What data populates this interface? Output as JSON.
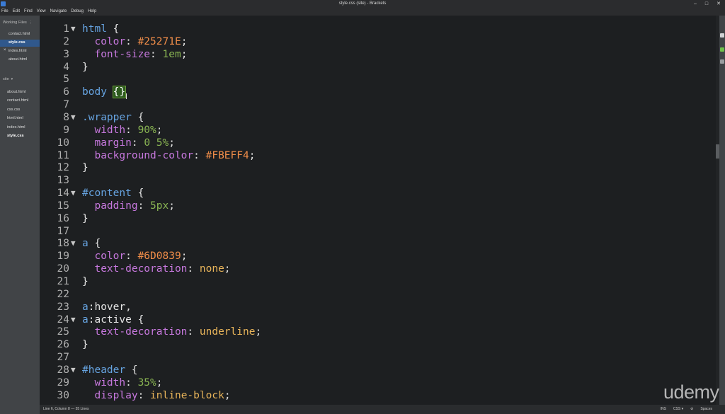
{
  "window": {
    "title": "style.css (site) - Brackets",
    "controls": [
      "–",
      "□",
      "✕"
    ]
  },
  "menu": [
    "File",
    "Edit",
    "Find",
    "View",
    "Navigate",
    "Debug",
    "Help"
  ],
  "sidebar": {
    "working_files_title": "Working Files",
    "working_files": [
      {
        "name": "contact.html",
        "selected": false,
        "dirty": false
      },
      {
        "name": "style.css",
        "selected": true,
        "dirty": false
      },
      {
        "name": "index.html",
        "selected": false,
        "dirty": true
      },
      {
        "name": "about.html",
        "selected": false,
        "dirty": false
      }
    ],
    "project_title": "site",
    "project_files": [
      "about.html",
      "contact.html",
      "css.css",
      "html.html",
      "index.html",
      "style.css"
    ]
  },
  "code_lines": [
    {
      "n": "1",
      "fold": true,
      "tokens": [
        {
          "t": "html",
          "c": "sel"
        },
        {
          "t": " {",
          "c": "punc"
        }
      ]
    },
    {
      "n": "2",
      "fold": false,
      "tokens": [
        {
          "t": "  color",
          "c": "prop"
        },
        {
          "t": ": ",
          "c": "punc"
        },
        {
          "t": "#25271E",
          "c": "hex"
        },
        {
          "t": ";",
          "c": "punc"
        }
      ]
    },
    {
      "n": "3",
      "fold": false,
      "tokens": [
        {
          "t": "  font-size",
          "c": "prop"
        },
        {
          "t": ": ",
          "c": "punc"
        },
        {
          "t": "1em",
          "c": "num"
        },
        {
          "t": ";",
          "c": "punc"
        }
      ]
    },
    {
      "n": "4",
      "fold": false,
      "tokens": [
        {
          "t": "}",
          "c": "punc"
        }
      ]
    },
    {
      "n": "5",
      "fold": false,
      "tokens": []
    },
    {
      "n": "6",
      "fold": false,
      "tokens": [
        {
          "t": "body",
          "c": "sel"
        },
        {
          "t": " ",
          "c": "punc"
        },
        {
          "t": "{}",
          "c": "match"
        }
      ]
    },
    {
      "n": "7",
      "fold": false,
      "tokens": []
    },
    {
      "n": "8",
      "fold": true,
      "tokens": [
        {
          "t": ".wrapper",
          "c": "sel"
        },
        {
          "t": " {",
          "c": "punc"
        }
      ]
    },
    {
      "n": "9",
      "fold": false,
      "tokens": [
        {
          "t": "  width",
          "c": "prop"
        },
        {
          "t": ": ",
          "c": "punc"
        },
        {
          "t": "90%",
          "c": "num"
        },
        {
          "t": ";",
          "c": "punc"
        }
      ]
    },
    {
      "n": "10",
      "fold": false,
      "tokens": [
        {
          "t": "  margin",
          "c": "prop"
        },
        {
          "t": ": ",
          "c": "punc"
        },
        {
          "t": "0 5%",
          "c": "num"
        },
        {
          "t": ";",
          "c": "punc"
        }
      ]
    },
    {
      "n": "11",
      "fold": false,
      "tokens": [
        {
          "t": "  background-color",
          "c": "prop"
        },
        {
          "t": ": ",
          "c": "punc"
        },
        {
          "t": "#FBEFF4",
          "c": "hex"
        },
        {
          "t": ";",
          "c": "punc"
        }
      ]
    },
    {
      "n": "12",
      "fold": false,
      "tokens": [
        {
          "t": "}",
          "c": "punc"
        }
      ]
    },
    {
      "n": "13",
      "fold": false,
      "tokens": []
    },
    {
      "n": "14",
      "fold": true,
      "tokens": [
        {
          "t": "#content",
          "c": "sel"
        },
        {
          "t": " {",
          "c": "punc"
        }
      ]
    },
    {
      "n": "15",
      "fold": false,
      "tokens": [
        {
          "t": "  padding",
          "c": "prop"
        },
        {
          "t": ": ",
          "c": "punc"
        },
        {
          "t": "5px",
          "c": "num"
        },
        {
          "t": ";",
          "c": "punc"
        }
      ]
    },
    {
      "n": "16",
      "fold": false,
      "tokens": [
        {
          "t": "}",
          "c": "punc"
        }
      ]
    },
    {
      "n": "17",
      "fold": false,
      "tokens": []
    },
    {
      "n": "18",
      "fold": true,
      "tokens": [
        {
          "t": "a",
          "c": "sel"
        },
        {
          "t": " {",
          "c": "punc"
        }
      ]
    },
    {
      "n": "19",
      "fold": false,
      "tokens": [
        {
          "t": "  color",
          "c": "prop"
        },
        {
          "t": ": ",
          "c": "punc"
        },
        {
          "t": "#6D0839",
          "c": "hex"
        },
        {
          "t": ";",
          "c": "punc"
        }
      ]
    },
    {
      "n": "20",
      "fold": false,
      "tokens": [
        {
          "t": "  text-decoration",
          "c": "prop"
        },
        {
          "t": ": ",
          "c": "punc"
        },
        {
          "t": "none",
          "c": "val"
        },
        {
          "t": ";",
          "c": "punc"
        }
      ]
    },
    {
      "n": "21",
      "fold": false,
      "tokens": [
        {
          "t": "}",
          "c": "punc"
        }
      ]
    },
    {
      "n": "22",
      "fold": false,
      "tokens": []
    },
    {
      "n": "23",
      "fold": false,
      "tokens": [
        {
          "t": "a",
          "c": "sel"
        },
        {
          "t": ":hover,",
          "c": "punc"
        }
      ]
    },
    {
      "n": "24",
      "fold": true,
      "tokens": [
        {
          "t": "a",
          "c": "sel"
        },
        {
          "t": ":active {",
          "c": "punc"
        }
      ]
    },
    {
      "n": "25",
      "fold": false,
      "tokens": [
        {
          "t": "  text-decoration",
          "c": "prop"
        },
        {
          "t": ": ",
          "c": "punc"
        },
        {
          "t": "underline",
          "c": "val"
        },
        {
          "t": ";",
          "c": "punc"
        }
      ]
    },
    {
      "n": "26",
      "fold": false,
      "tokens": [
        {
          "t": "}",
          "c": "punc"
        }
      ]
    },
    {
      "n": "27",
      "fold": false,
      "tokens": []
    },
    {
      "n": "28",
      "fold": true,
      "tokens": [
        {
          "t": "#header",
          "c": "sel"
        },
        {
          "t": " {",
          "c": "punc"
        }
      ]
    },
    {
      "n": "29",
      "fold": false,
      "tokens": [
        {
          "t": "  width",
          "c": "prop"
        },
        {
          "t": ": ",
          "c": "punc"
        },
        {
          "t": "35%",
          "c": "num"
        },
        {
          "t": ";",
          "c": "punc"
        }
      ]
    },
    {
      "n": "30",
      "fold": false,
      "tokens": [
        {
          "t": "  display",
          "c": "prop"
        },
        {
          "t": ": ",
          "c": "punc"
        },
        {
          "t": "inline-block",
          "c": "val"
        },
        {
          "t": ";",
          "c": "punc"
        }
      ]
    }
  ],
  "status": {
    "cursor": "Line 6, Column 8 — 55 Lines",
    "ins": "INS",
    "language": "CSS ▾",
    "indent": "Spaces"
  },
  "watermark": "udemy",
  "colors": {
    "selector": "#66a3e0",
    "property": "#c678dd",
    "hex": "#f08d49",
    "number": "#8ab553",
    "keyword_value": "#e8b45a",
    "sidebar_bg": "#414447",
    "editor_bg": "#1d1f21"
  }
}
